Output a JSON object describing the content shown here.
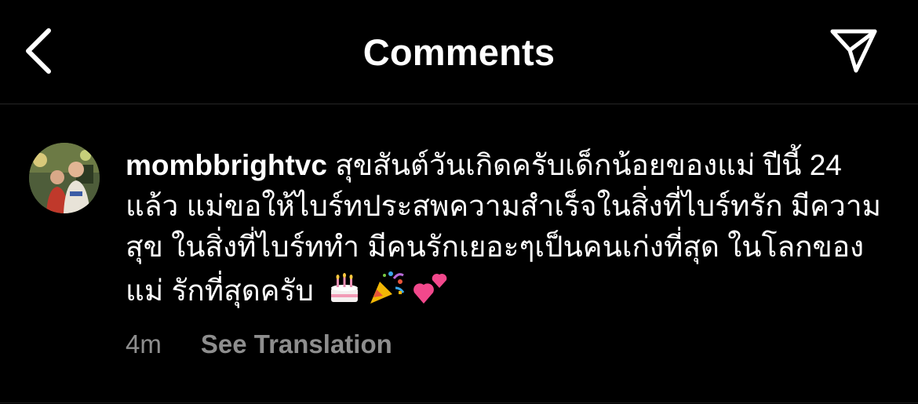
{
  "header": {
    "title": "Comments",
    "back_icon": "chevron-left-icon",
    "share_icon": "paper-plane-icon"
  },
  "comment": {
    "username": "mombbrightvc",
    "text": "สุขสันต์วันเกิดครับเด็กน้อยของแม่ ปีนี้ 24 แล้ว แม่ขอให้ไบร์ทประสพความสำเร็จในสิ่งที่ไบร์ทรัก มีความสุข ในสิ่งที่ไบร์ททำ มีคนรักเยอะๆเป็นคนเก่งที่สุด ในโลกของแม่ รักที่สุดครับ",
    "emojis": [
      "birthday-cake-icon",
      "party-popper-icon",
      "two-hearts-icon"
    ],
    "time": "4m",
    "see_translation": "See Translation"
  },
  "colors": {
    "background": "#000000",
    "text_primary": "#ffffff",
    "text_secondary": "#8e8e8e",
    "divider": "#262626"
  }
}
